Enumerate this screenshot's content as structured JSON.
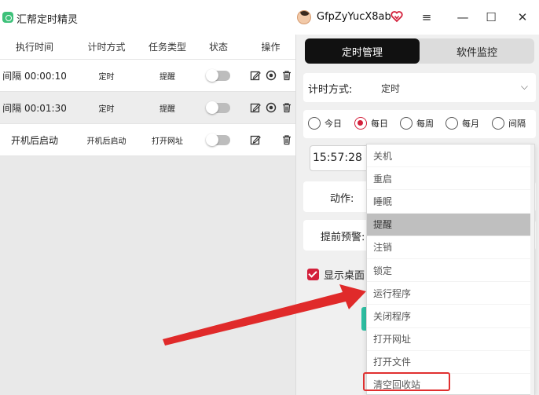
{
  "window": {
    "title": "汇帮定时精灵",
    "username": "GfpZyYucX8ab",
    "controls": {
      "menu": "≡",
      "minimize": "—",
      "maximize": "☐",
      "close": "✕"
    }
  },
  "table": {
    "headers": [
      "执行时间",
      "计时方式",
      "任务类型",
      "状态",
      "操作"
    ],
    "rows": [
      {
        "time": "间隔 00:00:10",
        "mode": "定时",
        "type": "提醒"
      },
      {
        "time": "间隔 00:01:30",
        "mode": "定时",
        "type": "提醒"
      },
      {
        "time": "开机后启动",
        "mode": "开机后启动",
        "type": "打开网址"
      }
    ]
  },
  "tabs": {
    "active": "定时管理",
    "inactive": "软件监控"
  },
  "form": {
    "timing_label": "计时方式:",
    "timing_value": "定时",
    "radios": [
      "今日",
      "每日",
      "每周",
      "每月",
      "间隔"
    ],
    "selected_radio": "每日",
    "time_value": "15:57:28",
    "action_label": "动作:",
    "warn_label": "提前预警:",
    "desktop_label": "显示桌面"
  },
  "dropdown": {
    "items": [
      "关机",
      "重启",
      "睡眠",
      "提醒",
      "注销",
      "锁定",
      "运行程序",
      "关闭程序",
      "打开网址",
      "打开文件",
      "清空回收站"
    ],
    "selected": "提醒",
    "highlighted": "清空回收站"
  },
  "colors": {
    "accent": "#d3203b",
    "tab_active": "#111111",
    "arrow": "#e03030",
    "teal": "#2ebfa3"
  }
}
